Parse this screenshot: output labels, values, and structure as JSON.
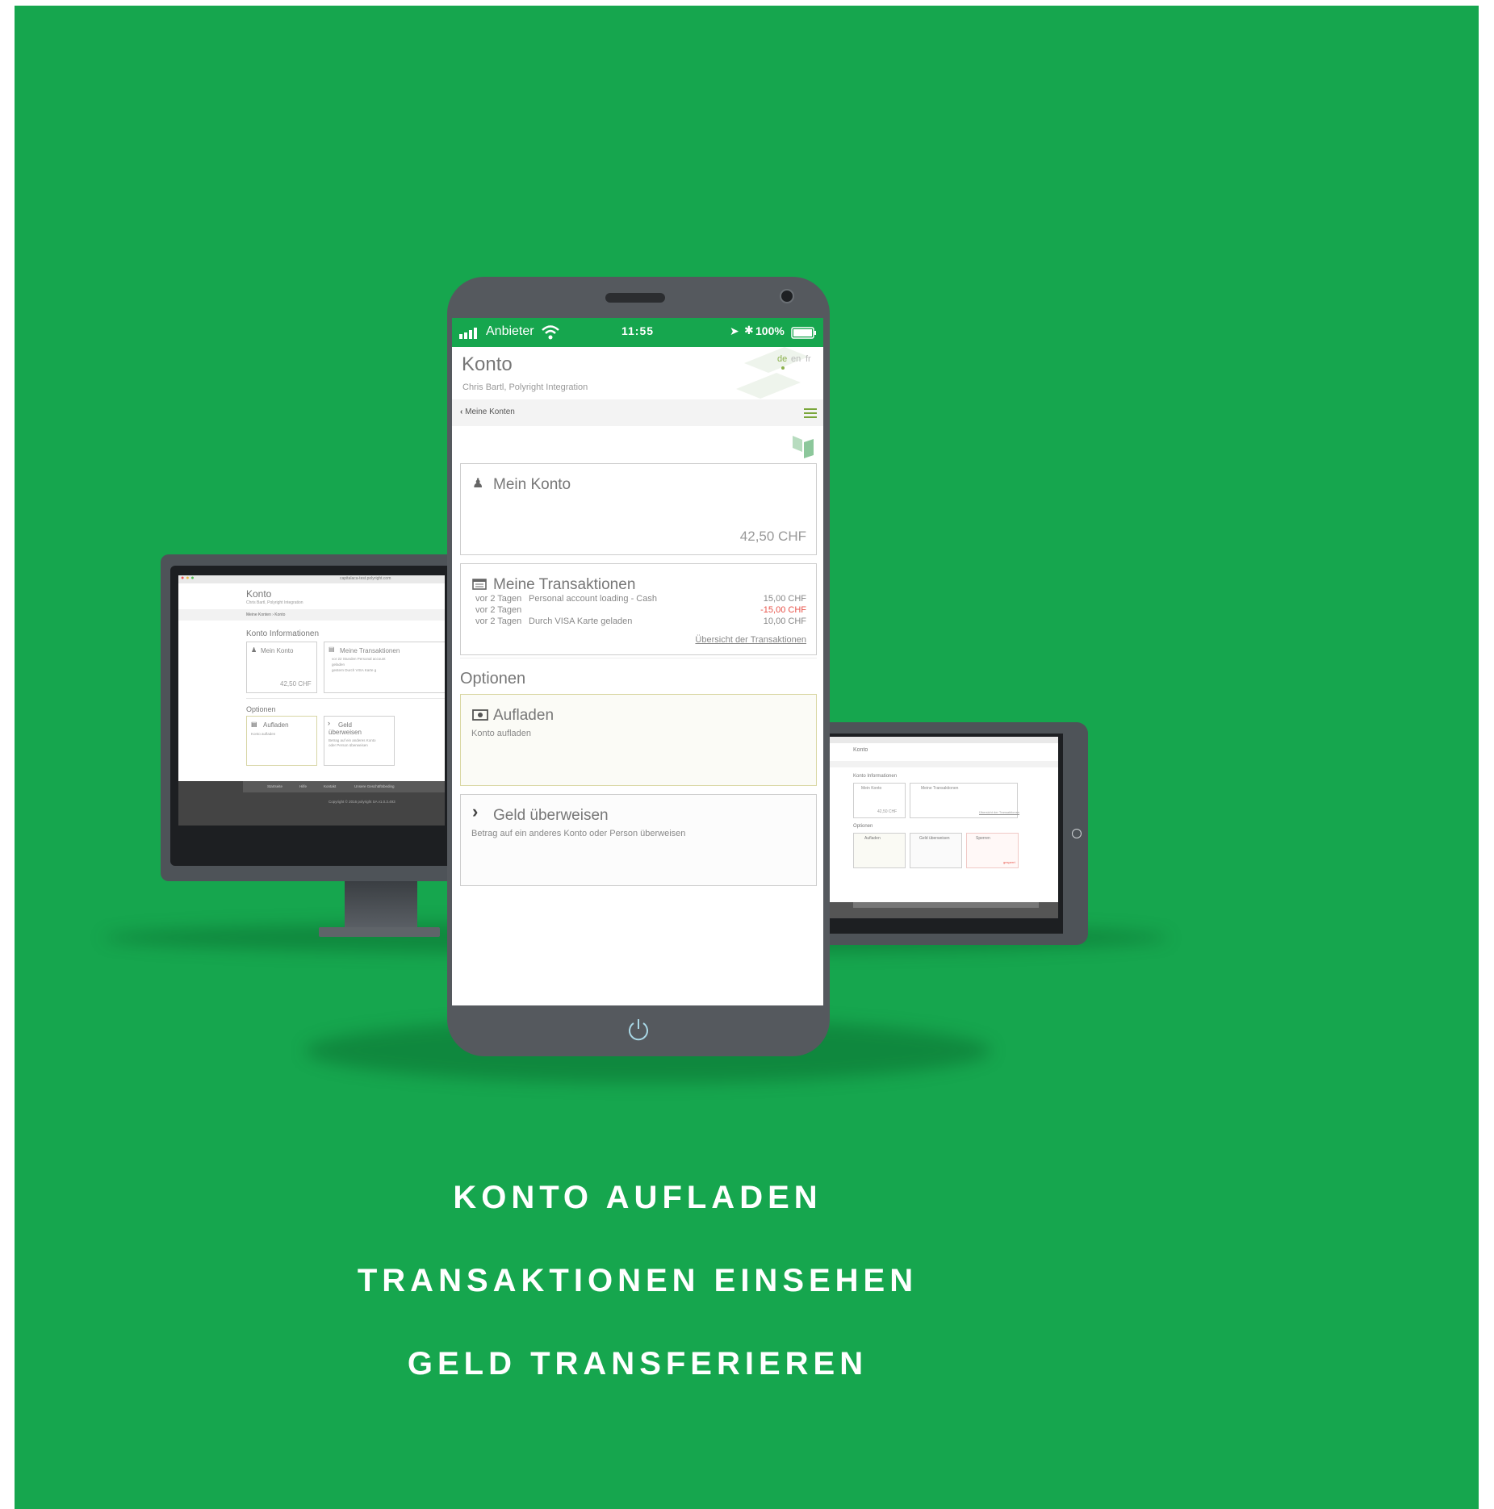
{
  "features": [
    "KONTO AUFLADEN",
    "TRANSAKTIONEN EINSEHEN",
    "GELD TRANSFERIEREN"
  ],
  "colors": {
    "brand_green": "#16a64e",
    "accent_olive": "#7aa63a",
    "negative_red": "#e8534a",
    "device_gray": "#55595e"
  },
  "phone": {
    "status": {
      "carrier": "Anbieter",
      "time": "11:55",
      "battery": "100%"
    },
    "header": {
      "title": "Konto",
      "subtitle": "Chris Bartl, Polyright Integration",
      "languages": [
        "de",
        "en",
        "fr"
      ]
    },
    "nav": {
      "back_label": "Meine Konten"
    },
    "account_card": {
      "title": "Mein Konto",
      "balance": "42,50 CHF"
    },
    "transactions_card": {
      "title": "Meine Transaktionen",
      "rows": [
        {
          "when": "vor 2 Tagen",
          "text": "Personal account loading - Cash",
          "amount": "15,00 CHF"
        },
        {
          "when": "vor 2 Tagen",
          "text": "",
          "amount": "-15,00 CHF"
        },
        {
          "when": "vor 2 Tagen",
          "text": "Durch VISA Karte geladen",
          "amount": "10,00 CHF"
        }
      ],
      "overview_link": "Übersicht der Transaktionen"
    },
    "options": {
      "heading": "Optionen",
      "topup": {
        "title": "Aufladen",
        "desc": "Konto aufladen"
      },
      "transfer": {
        "title": "Geld überweisen",
        "desc": "Betrag auf ein anderes Konto oder Person überweisen"
      }
    }
  },
  "desktop": {
    "url": "capitalaca-test.polyright.com",
    "title": "Konto",
    "subtitle": "Chris Bartl, Polyright Integration",
    "breadcrumb": "Meine Konten  ›  Konto",
    "section": "Konto Informationen",
    "account_title": "Mein Konto",
    "balance": "42,50 CHF",
    "transactions_title": "Meine Transaktionen",
    "tx_line1": "vor 22 Stunden   Personal account",
    "tx_line2": "geladen",
    "tx_line3": "gestern            Durch VISA Karte g",
    "options_heading": "Optionen",
    "topup_title": "Aufladen",
    "topup_desc": "Konto aufladen",
    "transfer_title": "Geld",
    "transfer_title2": "überweisen",
    "transfer_desc": "Betrag auf ein anderes Konto",
    "transfer_desc2": "oder Person überweisen",
    "footer_links": [
      "Startseite",
      "Hilfe",
      "Kontakt",
      "Unsere Geschäftsbeding"
    ],
    "copyright": "Copyright © 2016 polyright SA     v1.0.3.493"
  },
  "tablet": {
    "title": "Konto",
    "section": "Konto Informationen",
    "account_title": "Mein Konto",
    "balance": "42,50 CHF",
    "transactions_title": "Meine Transaktionen",
    "overview_link": "Übersicht der Transaktionen",
    "options_heading": "Optionen",
    "topup_title": "Aufladen",
    "transfer_title": "Geld überweisen",
    "block_title": "Sperren",
    "block_link": "gesperrt"
  }
}
